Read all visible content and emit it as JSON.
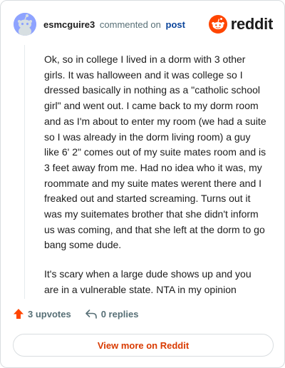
{
  "header": {
    "author": "esmcguire3",
    "verb": "commented on",
    "post_link": "post",
    "logo_text": "reddit"
  },
  "comment": {
    "paragraphs": [
      "Ok, so in college I lived in a dorm with 3 other girls. It was halloween and it was college so I dressed basically in nothing as a \"catholic school girl\" and went out. I came back to my dorm room and as I'm about to enter my room (we had a suite so I was already in the dorm living room) a guy like 6' 2\" comes out of my suite mates room and is 3 feet away from me. Had no idea who it was, my roommate and my suite mates werent there and I freaked out and started screaming. Turns out it was my suitemates brother that she didn't inform us was coming, and that she left at the dorm to go bang some dude.",
      "It's scary when a large dude shows up and you are in a vulnerable state. NTA in my opinion"
    ]
  },
  "actions": {
    "upvotes": "3 upvotes",
    "replies": "0 replies"
  },
  "footer": {
    "view_more": "View more on Reddit"
  },
  "icons": {
    "avatar": "snoo-avatar-icon",
    "logo": "reddit-logo-icon",
    "upvote": "upvote-arrow-icon",
    "reply": "reply-arrow-icon"
  },
  "colors": {
    "brand": "#ff4500",
    "link": "#0a449b",
    "view_more": "#d93a00",
    "muted": "#576f76"
  }
}
